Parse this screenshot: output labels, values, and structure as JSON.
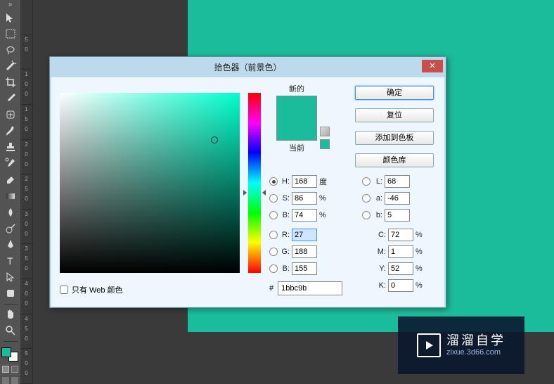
{
  "ruler": [
    "",
    "5 0",
    "1 0 0",
    "1 5 0",
    "2 0 0",
    "2 5 0",
    "3 0 0",
    "3 5 0",
    "4 0 0",
    "4 5 0",
    "5 0 0"
  ],
  "dialog": {
    "title": "拾色器（前景色）",
    "close": "✕",
    "new_label": "新的",
    "current_label": "当前",
    "buttons": {
      "ok": "确定",
      "reset": "复位",
      "add_swatch": "添加到色板",
      "color_lib": "颜色库"
    },
    "hsb": {
      "h": "168",
      "s": "86",
      "b": "74",
      "h_unit": "度"
    },
    "lab": {
      "l": "68",
      "a": "-46",
      "b": "5"
    },
    "rgb": {
      "r": "27",
      "g": "188",
      "b": "155"
    },
    "cmyk": {
      "c": "72",
      "m": "1",
      "y": "52",
      "k": "0"
    },
    "hex": "1bbc9b",
    "web_only": "只有 Web 颜色"
  },
  "watermark": {
    "big": "溜溜自学",
    "small": "zixue.3d66.com"
  },
  "chart_data": {
    "type": "table",
    "title": "Color Picker Values",
    "rows": [
      {
        "model": "HSB",
        "values": [
          168,
          86,
          74
        ],
        "units": [
          "度",
          "%",
          "%"
        ]
      },
      {
        "model": "Lab",
        "values": [
          68,
          -46,
          5
        ]
      },
      {
        "model": "RGB",
        "values": [
          27,
          188,
          155
        ]
      },
      {
        "model": "CMYK",
        "values": [
          72,
          1,
          52,
          0
        ],
        "units": [
          "%",
          "%",
          "%",
          "%"
        ]
      },
      {
        "model": "Hex",
        "values": [
          "1bbc9b"
        ]
      }
    ]
  }
}
